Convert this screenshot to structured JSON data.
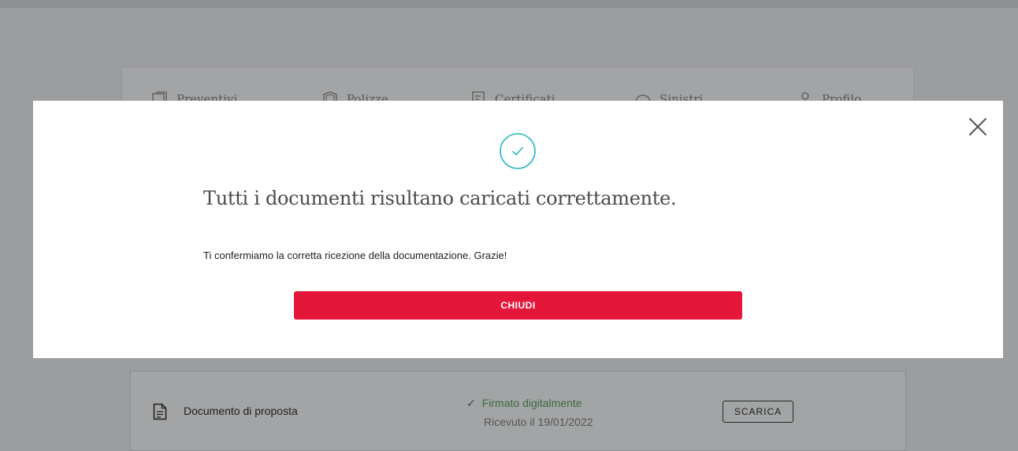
{
  "nav": {
    "items": [
      {
        "label": "Preventivi",
        "icon": "quotes-icon"
      },
      {
        "label": "Polizze",
        "icon": "shield-icon"
      },
      {
        "label": "Certificati",
        "icon": "certificate-icon"
      },
      {
        "label": "Sinistri",
        "icon": "car-icon"
      },
      {
        "label": "Profilo",
        "icon": "user-icon"
      }
    ]
  },
  "modal": {
    "title": "Tutti i documenti risultano caricati correttamente.",
    "message": "Ti confermiamo la corretta ricezione della documentazione. Grazie!",
    "close_button_label": "CHIUDI",
    "accent_color": "#e4173a",
    "success_color": "#2ab7c4"
  },
  "document": {
    "title": "Documento di proposta",
    "status": "Firmato digitalmente",
    "status_check": "✓",
    "received": "Ricevuto il 19/01/2022",
    "download_label": "SCARICA"
  }
}
